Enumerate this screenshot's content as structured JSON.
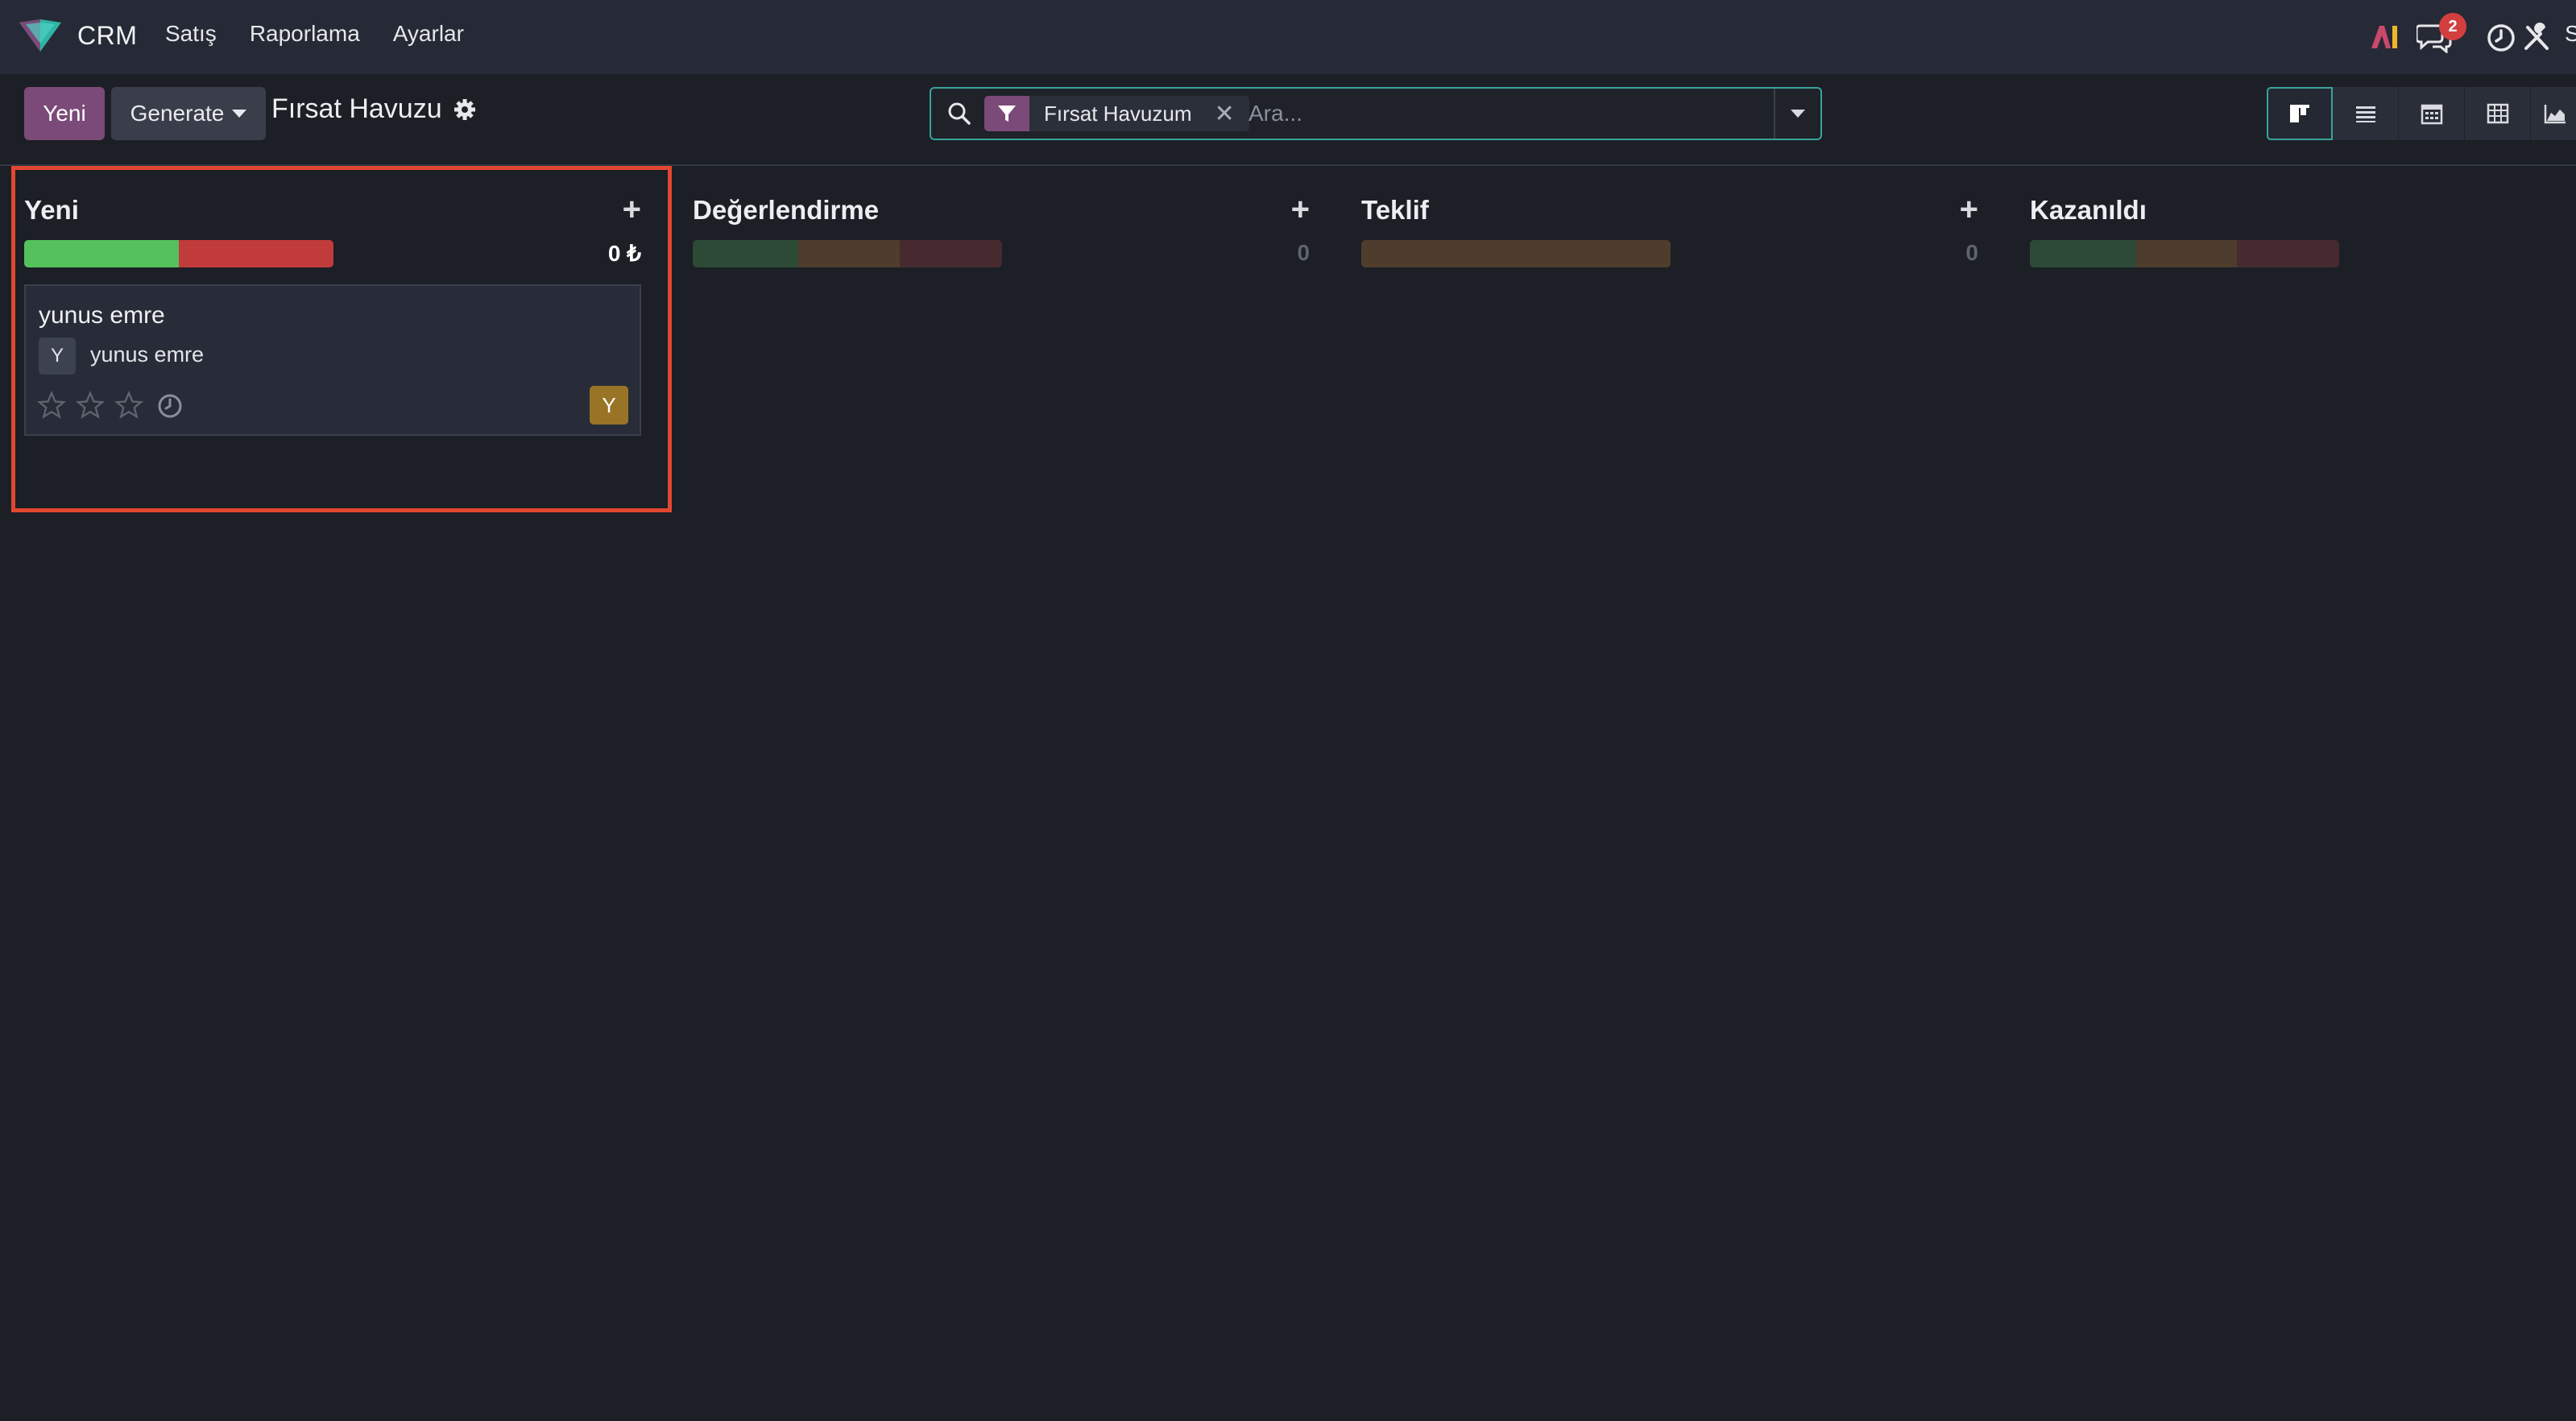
{
  "navbar": {
    "app_name": "CRM",
    "menu": [
      "Satış",
      "Raporlama",
      "Ayarlar"
    ],
    "messages_badge": "2",
    "user_initial": "S"
  },
  "control_panel": {
    "new_button": "Yeni",
    "generate_button": "Generate",
    "view_title": "Fırsat Havuzu",
    "search": {
      "facet_label": "Fırsat Havuzum",
      "placeholder": "Ara..."
    },
    "views": [
      "kanban",
      "list",
      "calendar",
      "pivot",
      "graph"
    ]
  },
  "columns": [
    {
      "title": "Yeni",
      "total": "0 ₺",
      "progress": [
        {
          "color": "#55c15e",
          "fraction": 0.5
        },
        {
          "color": "#c23b3b",
          "fraction": 0.5
        }
      ],
      "cards": [
        {
          "title": "yunus emre",
          "partner_initial": "Y",
          "partner": "yunus emre",
          "stars": 0,
          "user_initial": "Y"
        }
      ]
    },
    {
      "title": "Değerlendirme",
      "total": "0",
      "progress": [
        {
          "color": "#2c4a36",
          "fraction": 0.34
        },
        {
          "color": "#4e3d2c",
          "fraction": 0.33
        },
        {
          "color": "#472a30",
          "fraction": 0.33
        }
      ]
    },
    {
      "title": "Teklif",
      "total": "0",
      "progress": [
        {
          "color": "#4e3d2c",
          "fraction": 1.0
        }
      ]
    },
    {
      "title": "Kazanıldı",
      "total": "",
      "progress": [
        {
          "color": "#2c4a36",
          "fraction": 0.34
        },
        {
          "color": "#4e3d2c",
          "fraction": 0.33
        },
        {
          "color": "#472a30",
          "fraction": 0.33
        }
      ]
    }
  ]
}
